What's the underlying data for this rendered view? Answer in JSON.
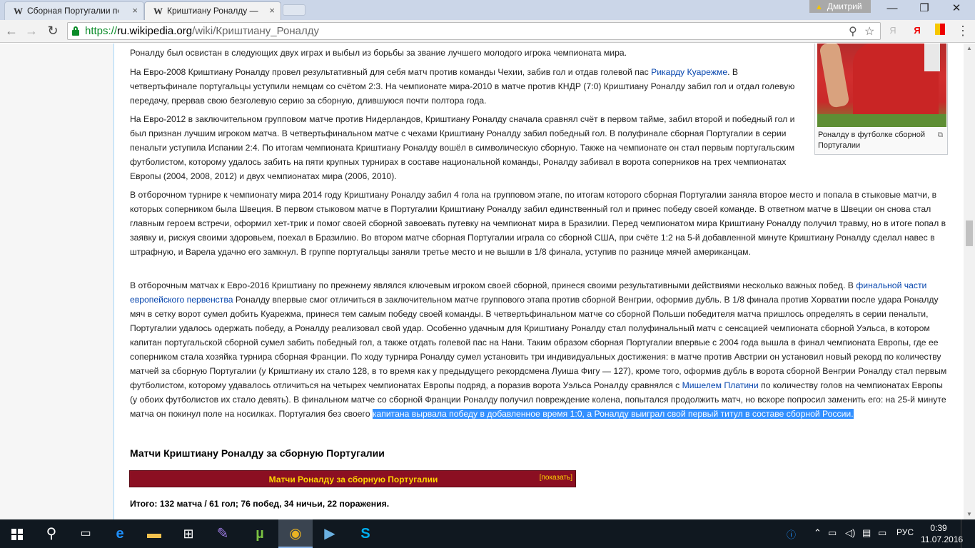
{
  "browser": {
    "tabs": [
      {
        "favicon": "W",
        "title": "Сборная Португалии по",
        "close": "×"
      },
      {
        "favicon": "W",
        "title": "Криштиану Роналду — В",
        "close": "×"
      }
    ],
    "profile_name": "Дмитрий",
    "window": {
      "minimize": "—",
      "restore": "❐",
      "close": "✕"
    },
    "url": {
      "scheme": "https://",
      "host": "ru.wikipedia.org",
      "path": "/wiki/Криштиану_Роналду"
    },
    "nav": {
      "back": "←",
      "forward": "→",
      "reload": "↻",
      "menu": "⋮"
    },
    "icons": {
      "zoom": "search-icon",
      "bookmark": "star-icon"
    }
  },
  "article": {
    "p0": "Роналду был освистан в следующих двух играх и выбыл из борьбы за звание лучшего молодого игрока чемпионата мира.",
    "p1": {
      "a": "На Евро-2008 Криштиану Роналду провел результативный для себя матч против команды Чехии, забив гол и отдав голевой пас ",
      "link": "Рикарду Куарежме",
      "b": ". В четвертьфинале португальцы уступили немцам со счётом 2:3. На чемпионате мира-2010 в матче против КНДР (7:0) Криштиану Роналду забил гол и отдал голевую передачу, прервав свою безголевую серию за сборную, длившуюся почти полтора года."
    },
    "p2": "На Евро-2012 в заключительном групповом матче против Нидерландов, Криштиану Роналду сначала сравнял счёт в первом тайме, забил второй и победный гол и был признан лучшим игроком матча. В четвертьфинальном матче с чехами Криштиану Роналду забил победный гол. В полуфинале сборная Португалии в серии пенальти уступила Испании 2:4. По итогам чемпионата Криштиану Роналду вошёл в символическую сборную. Также на чемпионате он стал первым португальским футболистом, которому удалось забить на пяти крупных турнирах в составе национальной команды, Роналду забивал в ворота соперников на трех чемпионатах Европы (2004, 2008, 2012) и двух чемпионатах мира (2006, 2010).",
    "p3": "В отборочном турнире к чемпионату мира 2014 году Криштиану Роналду забил 4 гола на групповом этапе, по итогам которого сборная Португалии заняла второе место и попала в стыковые матчи, в которых соперником была Швеция. В первом стыковом матче в Португалии Криштиану Роналду забил единственный гол и принес победу своей команде. В ответном матче в Швеции он снова стал главным героем встречи, оформил хет-трик и помог своей сборной завоевать путевку на чемпионат мира в Бразилии. Перед чемпионатом мира Криштиану Роналду получил травму, но в итоге попал в заявку и, рискуя своими здоровьем, поехал в Бразилию. Во втором матче сборная Португалии играла со сборной США, при счёте 1:2 на 5-й добавленной минуте Криштиану Роналду сделал навес в штрафную, и Варела удачно его замкнул. В группе португальцы заняли третье место и не вышли в 1/8 финала, уступив по разнице мячей американцам.",
    "p4": {
      "a": "В отборочным матчах к Евро-2016 Криштиану по прежнему являлся ключевым игроком своей сборной, принеся своими результативными действиями несколько важных побед. В ",
      "link1": "финальной части европейского первенства",
      "b": " Роналду впервые смог отличиться в заключительном матче группового этапа против сборной Венгрии, оформив дубль. В 1/8 финала против Хорватии после удара Роналду мяч в сетку ворот сумел добить Куарежма, принеся тем самым победу своей команды. В четвертьфинальном матче со сборной Польши победителя матча пришлось определять в серии пенальти, Португалии удалось одержать победу, а Роналду реализовал свой удар. Особенно удачным для Криштиану Роналду стал полуфинальный матч с сенсацией чемпионата сборной Уэльса, в котором капитан португальской сборной сумел забить победный гол, а также отдать голевой пас на Нани. Таким образом сборная Португалии впервые с 2004 года вышла в финал чемпионата Европы, где ее соперником стала хозяйка турнира сборная Франции. По ходу турнира Роналду сумел установить три индивидуальных достижения: в матче против Австрии он установил новый рекорд по количеству матчей за сборную Португалии (у Криштиану их стало 128, в то время как у предыдущего рекордсмена Луиша Фигу — 127), кроме того, оформив дубль в ворота сборной Венгрии Роналду стал первым футболистом, которому удавалось отличиться на четырех чемпионатах Европы подряд, а поразив ворота Уэльса Роналду сравнялся с ",
      "link2": "Мишелем Платини",
      "c": " по количеству голов на чемпионатах Европы (у обоих футболистов их стало девять). В финальном матче со сборной Франции Роналду получил повреждение колена, попытался продолжить матч, но вскоре попросил заменить его: на 25-й минуте матча он покинул поле на носилках. Португалия без своего ",
      "selected": "капитана вырвала победу в добавленное время 1:0, а Роналду выиграл свой первый титул в составе сборной России."
    },
    "infobox_caption": "Роналду в футболке сборной Португалии",
    "section_title": "Матчи Криштиану Роналду за сборную Португалии",
    "navbox_title": "Матчи Роналду за сборную Португалии",
    "navbox_toggle": "[показать]",
    "totals": "Итого: 132 матча / 61 гол; 76 побед, 34 ничьи, 22 поражения."
  },
  "taskbar": {
    "language": "РУС",
    "time": "0:39",
    "date": "11.07.2016"
  },
  "colors": {
    "link": "#0645ad",
    "selection": "#3390ff",
    "navbox_bg": "#8b0f22",
    "navbox_text": "#ffd700",
    "taskbar": "#101820"
  }
}
